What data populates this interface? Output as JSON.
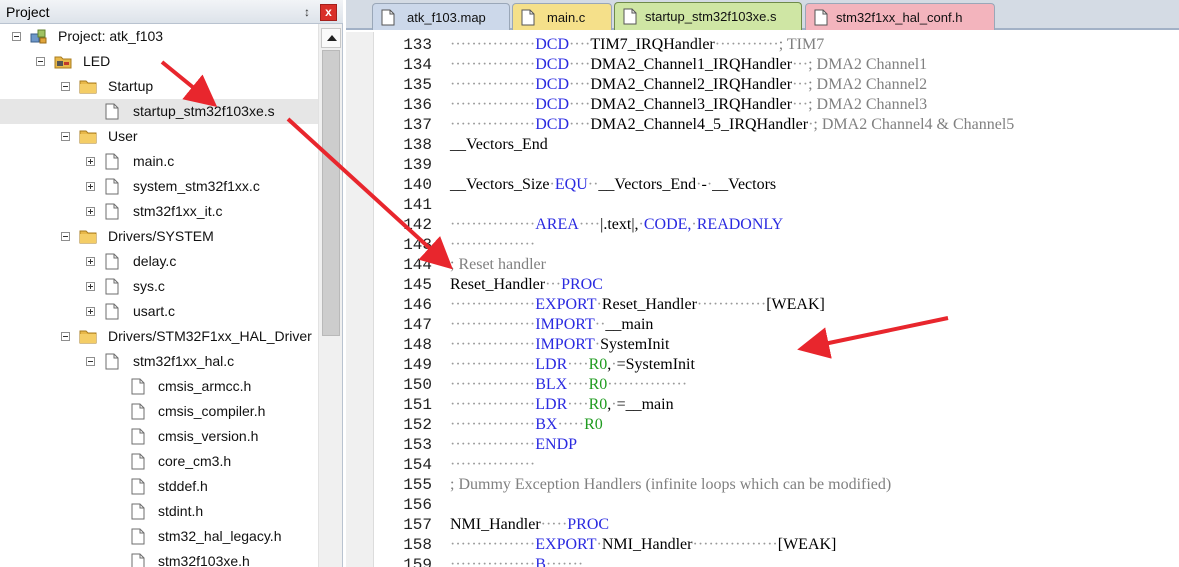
{
  "project_panel": {
    "title": "Project",
    "pin_glyph": "↕",
    "close_glyph": "x",
    "tree": [
      {
        "label": "Project: atk_f103",
        "icon": "project-icon",
        "toggle": "minus"
      },
      {
        "label": "LED",
        "icon": "target-folder-icon",
        "toggle": "minus"
      },
      {
        "label": "Startup",
        "icon": "folder-icon",
        "toggle": "minus"
      },
      {
        "label": "startup_stm32f103xe.s",
        "icon": "file-icon",
        "toggle": "none"
      },
      {
        "label": "User",
        "icon": "folder-icon",
        "toggle": "minus"
      },
      {
        "label": "main.c",
        "icon": "file-icon",
        "toggle": "plus"
      },
      {
        "label": "system_stm32f1xx.c",
        "icon": "file-icon",
        "toggle": "plus"
      },
      {
        "label": "stm32f1xx_it.c",
        "icon": "file-icon",
        "toggle": "plus"
      },
      {
        "label": "Drivers/SYSTEM",
        "icon": "folder-icon",
        "toggle": "minus"
      },
      {
        "label": "delay.c",
        "icon": "file-icon",
        "toggle": "plus"
      },
      {
        "label": "sys.c",
        "icon": "file-icon",
        "toggle": "plus"
      },
      {
        "label": "usart.c",
        "icon": "file-icon",
        "toggle": "plus"
      },
      {
        "label": "Drivers/STM32F1xx_HAL_Driver",
        "icon": "folder-icon",
        "toggle": "minus"
      },
      {
        "label": "stm32f1xx_hal.c",
        "icon": "file-icon",
        "toggle": "minus"
      },
      {
        "label": "cmsis_armcc.h",
        "icon": "file-icon",
        "toggle": "none"
      },
      {
        "label": "cmsis_compiler.h",
        "icon": "file-icon",
        "toggle": "none"
      },
      {
        "label": "cmsis_version.h",
        "icon": "file-icon",
        "toggle": "none"
      },
      {
        "label": "core_cm3.h",
        "icon": "file-icon",
        "toggle": "none"
      },
      {
        "label": "stddef.h",
        "icon": "file-icon",
        "toggle": "none"
      },
      {
        "label": "stdint.h",
        "icon": "file-icon",
        "toggle": "none"
      },
      {
        "label": "stm32_hal_legacy.h",
        "icon": "file-icon",
        "toggle": "none"
      },
      {
        "label": "stm32f103xe.h",
        "icon": "file-icon",
        "toggle": "none"
      }
    ]
  },
  "editor": {
    "tabs": [
      {
        "label": "atk_f103.map",
        "color": "#ccd8ea",
        "active": false
      },
      {
        "label": "main.c",
        "color": "#f5e08a",
        "active": false
      },
      {
        "label": "startup_stm32f103xe.s",
        "color": "#cfe6a4",
        "active": true
      },
      {
        "label": "stm32f1xx_hal_conf.h",
        "color": "#f3b4bd",
        "active": false
      }
    ],
    "lines": [
      {
        "n": "133",
        "seg": [
          {
            "c": "dt",
            "t": "················"
          },
          {
            "c": "kw",
            "t": "DCD"
          },
          {
            "c": "dt",
            "t": "····"
          },
          {
            "c": "",
            "t": "TIM7_IRQHandler"
          },
          {
            "c": "dt",
            "t": "············"
          },
          {
            "c": "cm",
            "t": "; TIM7"
          }
        ]
      },
      {
        "n": "134",
        "seg": [
          {
            "c": "dt",
            "t": "················"
          },
          {
            "c": "kw",
            "t": "DCD"
          },
          {
            "c": "dt",
            "t": "····"
          },
          {
            "c": "",
            "t": "DMA2_Channel1_IRQHandler"
          },
          {
            "c": "dt",
            "t": "···"
          },
          {
            "c": "cm",
            "t": "; DMA2 Channel1"
          }
        ]
      },
      {
        "n": "135",
        "seg": [
          {
            "c": "dt",
            "t": "················"
          },
          {
            "c": "kw",
            "t": "DCD"
          },
          {
            "c": "dt",
            "t": "····"
          },
          {
            "c": "",
            "t": "DMA2_Channel2_IRQHandler"
          },
          {
            "c": "dt",
            "t": "···"
          },
          {
            "c": "cm",
            "t": "; DMA2 Channel2"
          }
        ]
      },
      {
        "n": "136",
        "seg": [
          {
            "c": "dt",
            "t": "················"
          },
          {
            "c": "kw",
            "t": "DCD"
          },
          {
            "c": "dt",
            "t": "····"
          },
          {
            "c": "",
            "t": "DMA2_Channel3_IRQHandler"
          },
          {
            "c": "dt",
            "t": "···"
          },
          {
            "c": "cm",
            "t": "; DMA2 Channel3"
          }
        ]
      },
      {
        "n": "137",
        "seg": [
          {
            "c": "dt",
            "t": "················"
          },
          {
            "c": "kw",
            "t": "DCD"
          },
          {
            "c": "dt",
            "t": "····"
          },
          {
            "c": "",
            "t": "DMA2_Channel4_5_IRQHandler"
          },
          {
            "c": "dt",
            "t": "·"
          },
          {
            "c": "cm",
            "t": "; DMA2 Channel4 & Channel5"
          }
        ]
      },
      {
        "n": "138",
        "seg": [
          {
            "c": "",
            "t": "__Vectors_End"
          }
        ]
      },
      {
        "n": "139",
        "seg": []
      },
      {
        "n": "140",
        "seg": [
          {
            "c": "",
            "t": "__Vectors_Size"
          },
          {
            "c": "dt",
            "t": "·"
          },
          {
            "c": "kw",
            "t": "EQU"
          },
          {
            "c": "dt",
            "t": "··"
          },
          {
            "c": "",
            "t": "__Vectors_End"
          },
          {
            "c": "dt",
            "t": "·"
          },
          {
            "c": "",
            "t": "-"
          },
          {
            "c": "dt",
            "t": "·"
          },
          {
            "c": "",
            "t": "__Vectors"
          }
        ]
      },
      {
        "n": "141",
        "seg": []
      },
      {
        "n": "142",
        "seg": [
          {
            "c": "dt",
            "t": "················"
          },
          {
            "c": "kw",
            "t": "AREA"
          },
          {
            "c": "dt",
            "t": "····"
          },
          {
            "c": "",
            "t": "|.text|,"
          },
          {
            "c": "dt",
            "t": "·"
          },
          {
            "c": "kw",
            "t": "CODE,"
          },
          {
            "c": "dt",
            "t": "·"
          },
          {
            "c": "kw",
            "t": "READONLY"
          }
        ]
      },
      {
        "n": "143",
        "seg": [
          {
            "c": "dt",
            "t": "················"
          }
        ]
      },
      {
        "n": "144",
        "seg": [
          {
            "c": "cm",
            "t": "; Reset handler"
          }
        ]
      },
      {
        "n": "145",
        "seg": [
          {
            "c": "",
            "t": "Reset_Handler"
          },
          {
            "c": "dt",
            "t": "···"
          },
          {
            "c": "kw",
            "t": "PROC"
          }
        ]
      },
      {
        "n": "146",
        "seg": [
          {
            "c": "dt",
            "t": "················"
          },
          {
            "c": "kw",
            "t": "EXPORT"
          },
          {
            "c": "dt",
            "t": "·"
          },
          {
            "c": "",
            "t": "Reset_Handler"
          },
          {
            "c": "dt",
            "t": "·············"
          },
          {
            "c": "",
            "t": "[WEAK]"
          }
        ]
      },
      {
        "n": "147",
        "seg": [
          {
            "c": "dt",
            "t": "················"
          },
          {
            "c": "kw",
            "t": "IMPORT"
          },
          {
            "c": "dt",
            "t": "··"
          },
          {
            "c": "",
            "t": "__main"
          }
        ]
      },
      {
        "n": "148",
        "seg": [
          {
            "c": "dt",
            "t": "················"
          },
          {
            "c": "kw",
            "t": "IMPORT"
          },
          {
            "c": "dt",
            "t": "·"
          },
          {
            "c": "",
            "t": "SystemInit"
          }
        ]
      },
      {
        "n": "149",
        "seg": [
          {
            "c": "dt",
            "t": "················"
          },
          {
            "c": "kw",
            "t": "LDR"
          },
          {
            "c": "dt",
            "t": "····"
          },
          {
            "c": "rg",
            "t": "R0"
          },
          {
            "c": "",
            "t": ","
          },
          {
            "c": "dt",
            "t": "·"
          },
          {
            "c": "",
            "t": "=SystemInit"
          }
        ]
      },
      {
        "n": "150",
        "seg": [
          {
            "c": "dt",
            "t": "················"
          },
          {
            "c": "kw",
            "t": "BLX"
          },
          {
            "c": "dt",
            "t": "····"
          },
          {
            "c": "rg",
            "t": "R0"
          },
          {
            "c": "dt",
            "t": "···············"
          }
        ]
      },
      {
        "n": "151",
        "seg": [
          {
            "c": "dt",
            "t": "················"
          },
          {
            "c": "kw",
            "t": "LDR"
          },
          {
            "c": "dt",
            "t": "····"
          },
          {
            "c": "rg",
            "t": "R0"
          },
          {
            "c": "",
            "t": ","
          },
          {
            "c": "dt",
            "t": "·"
          },
          {
            "c": "",
            "t": "=__main"
          }
        ]
      },
      {
        "n": "152",
        "seg": [
          {
            "c": "dt",
            "t": "················"
          },
          {
            "c": "kw",
            "t": "BX"
          },
          {
            "c": "dt",
            "t": "·····"
          },
          {
            "c": "rg",
            "t": "R0"
          }
        ]
      },
      {
        "n": "153",
        "seg": [
          {
            "c": "dt",
            "t": "················"
          },
          {
            "c": "kw",
            "t": "ENDP"
          }
        ]
      },
      {
        "n": "154",
        "seg": [
          {
            "c": "dt",
            "t": "················"
          }
        ]
      },
      {
        "n": "155",
        "seg": [
          {
            "c": "cm",
            "t": "; Dummy Exception Handlers (infinite loops which can be modified)"
          }
        ]
      },
      {
        "n": "156",
        "seg": []
      },
      {
        "n": "157",
        "seg": [
          {
            "c": "",
            "t": "NMI_Handler"
          },
          {
            "c": "dt",
            "t": "·····"
          },
          {
            "c": "kw",
            "t": "PROC"
          }
        ]
      },
      {
        "n": "158",
        "seg": [
          {
            "c": "dt",
            "t": "················"
          },
          {
            "c": "kw",
            "t": "EXPORT"
          },
          {
            "c": "dt",
            "t": "·"
          },
          {
            "c": "",
            "t": "NMI_Handler"
          },
          {
            "c": "dt",
            "t": "················"
          },
          {
            "c": "",
            "t": "[WEAK]"
          }
        ]
      },
      {
        "n": "159",
        "seg": [
          {
            "c": "dt",
            "t": "················"
          },
          {
            "c": "kw",
            "t": "B"
          },
          {
            "c": "dt",
            "t": "·······"
          }
        ]
      }
    ]
  },
  "annotations": {
    "arrow_color": "#e8262d"
  }
}
